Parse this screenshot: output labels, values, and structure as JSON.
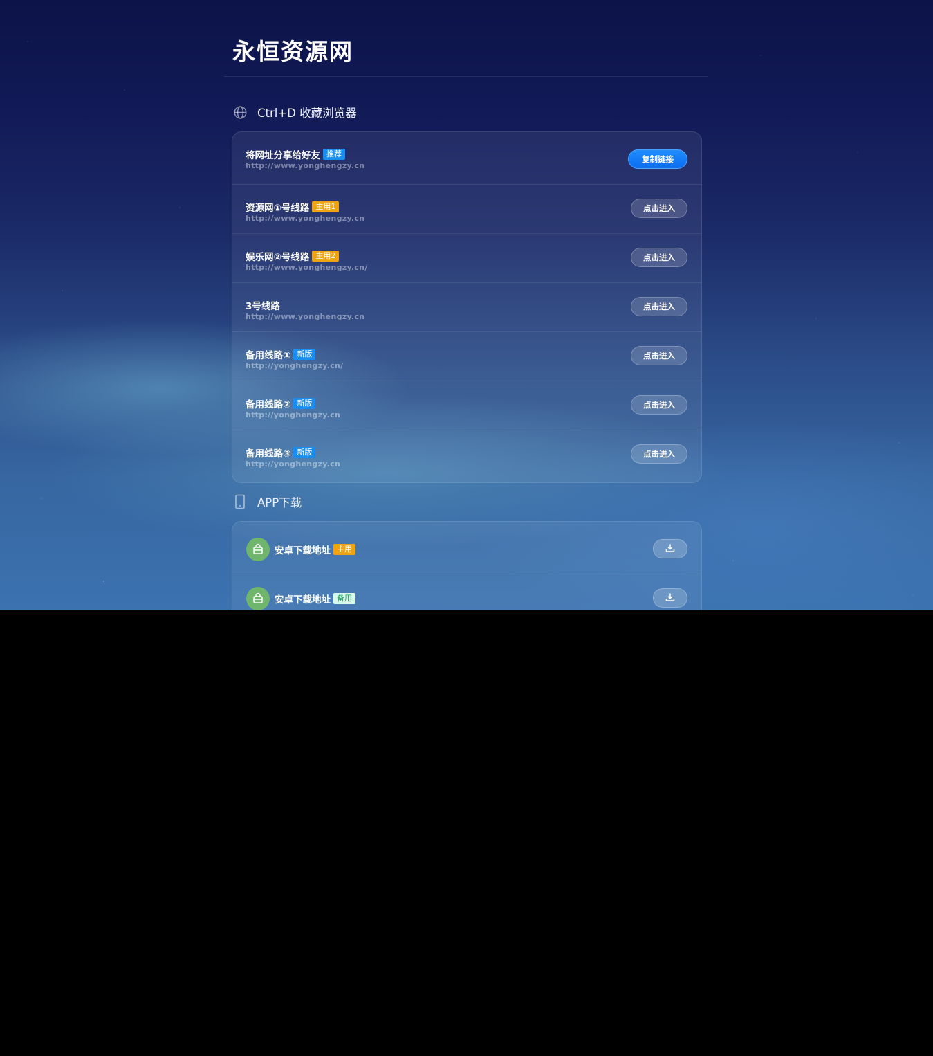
{
  "site": {
    "logo": "永恒资源网"
  },
  "bookmark_section": {
    "title": "Ctrl+D 收藏浏览器",
    "icon": "globe-icon"
  },
  "share_row": {
    "title": "将网址分享给好友",
    "tag": "推荐",
    "url": "http://www.yonghengzy.cn",
    "button": "复制链接"
  },
  "lines": [
    {
      "title": "资源网①号线路",
      "tag": "主用1",
      "tag_color": "orange",
      "url": "http://www.yonghengzy.cn",
      "button": "点击进入"
    },
    {
      "title": "娱乐网②号线路",
      "tag": "主用2",
      "tag_color": "orange",
      "url": "http://www.yonghengzy.cn/",
      "button": "点击进入"
    },
    {
      "title": "3号线路",
      "tag": "",
      "tag_color": "",
      "url": "http://www.yonghengzy.cn",
      "button": "点击进入"
    },
    {
      "title": "备用线路①",
      "tag": "新版",
      "tag_color": "blue",
      "url": "http://yonghengzy.cn/",
      "button": "点击进入"
    },
    {
      "title": "备用线路②",
      "tag": "新版",
      "tag_color": "blue",
      "url": "http://yonghengzy.cn",
      "button": "点击进入"
    },
    {
      "title": "备用线路③",
      "tag": "新版",
      "tag_color": "blue",
      "url": "http://yonghengzy.cn",
      "button": "点击进入"
    }
  ],
  "app_section": {
    "title": "APP下载",
    "icon": "phone-icon"
  },
  "apps": [
    {
      "title": "安卓下载地址",
      "tag": "主用",
      "tag_color": "orange",
      "icon": "android-icon",
      "button_icon": "download-icon"
    },
    {
      "title": "安卓下载地址",
      "tag": "备用",
      "tag_color": "mint",
      "icon": "android-icon",
      "button_icon": "download-icon"
    }
  ],
  "colors": {
    "accent_blue": "#1a8df0",
    "tag_orange": "#f0a412",
    "tag_mint": "#d7f8ea",
    "android_green": "#6fb56b"
  }
}
